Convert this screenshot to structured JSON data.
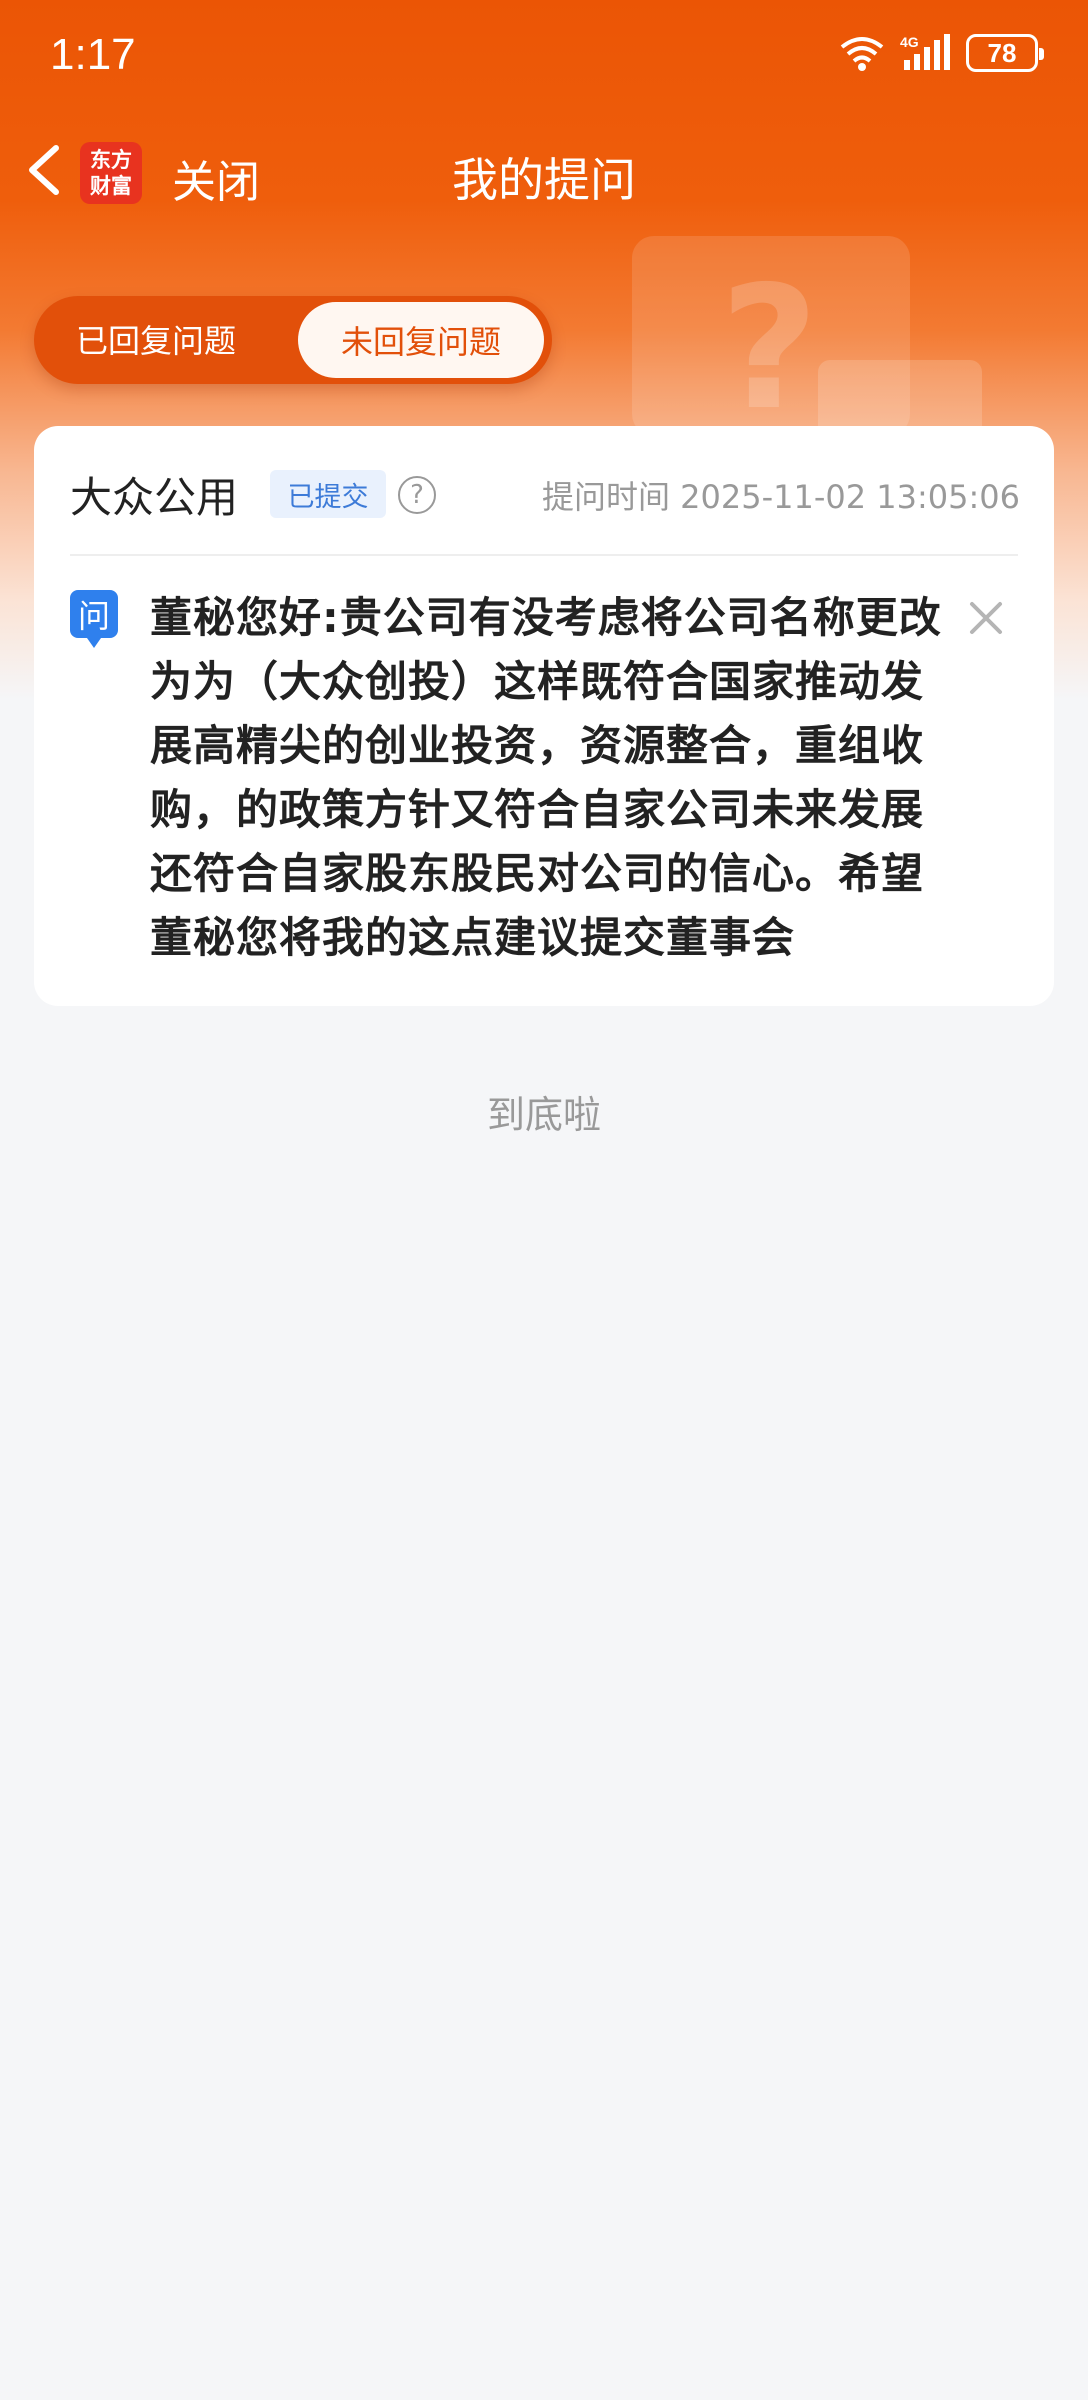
{
  "status_bar": {
    "time": "1:17",
    "battery": "78",
    "network": "4G"
  },
  "nav": {
    "close_label": "关闭",
    "title": "我的提问",
    "logo_line1": "东方",
    "logo_line2": "财富"
  },
  "tabs": [
    {
      "label": "已回复问题",
      "active": false
    },
    {
      "label": "未回复问题",
      "active": true
    }
  ],
  "question_card": {
    "stock_name": "大众公用",
    "status": "已提交",
    "help": "?",
    "ask_time": "提问时间 2025-11-02 13:05:06",
    "badge": "问",
    "lines": [
      "董秘您好:贵公司有没考虑将公司名称更改",
      "为为（大众创投）这样既符合国家推动发",
      "展高精尖的创业投资，资源整合，重组收",
      "购，的政策方针又符合自家公司未来发展",
      "还符合自家股东股民对公司的信心。希望",
      "董秘您将我的这点建议提交董事会"
    ]
  },
  "footer": {
    "end_text": "到底啦"
  },
  "colors": {
    "brand": "#eb5505",
    "tab_bg": "#e2500a",
    "badge_blue": "#2f80ed"
  }
}
